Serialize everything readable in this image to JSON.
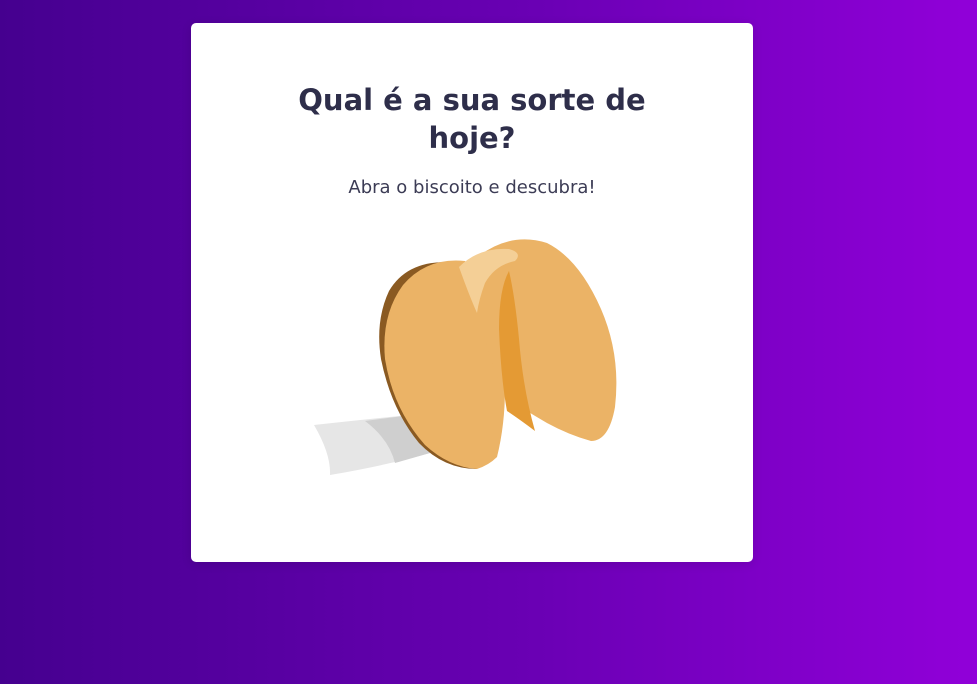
{
  "card": {
    "title_line1": "Qual é a sua sorte de",
    "title_line2": "hoje?",
    "subtitle": "Abra o biscoito e descubra!"
  },
  "icons": {
    "cookie": "fortune-cookie-icon"
  },
  "colors": {
    "gradient_start": "#45008f",
    "gradient_end": "#9100d9",
    "card_bg": "#ffffff",
    "title_color": "#2e2e4a",
    "cookie_main": "#ebb366",
    "cookie_dark": "#8a5a22",
    "cookie_inner": "#e49a34",
    "paper": "#e4e4e4"
  }
}
